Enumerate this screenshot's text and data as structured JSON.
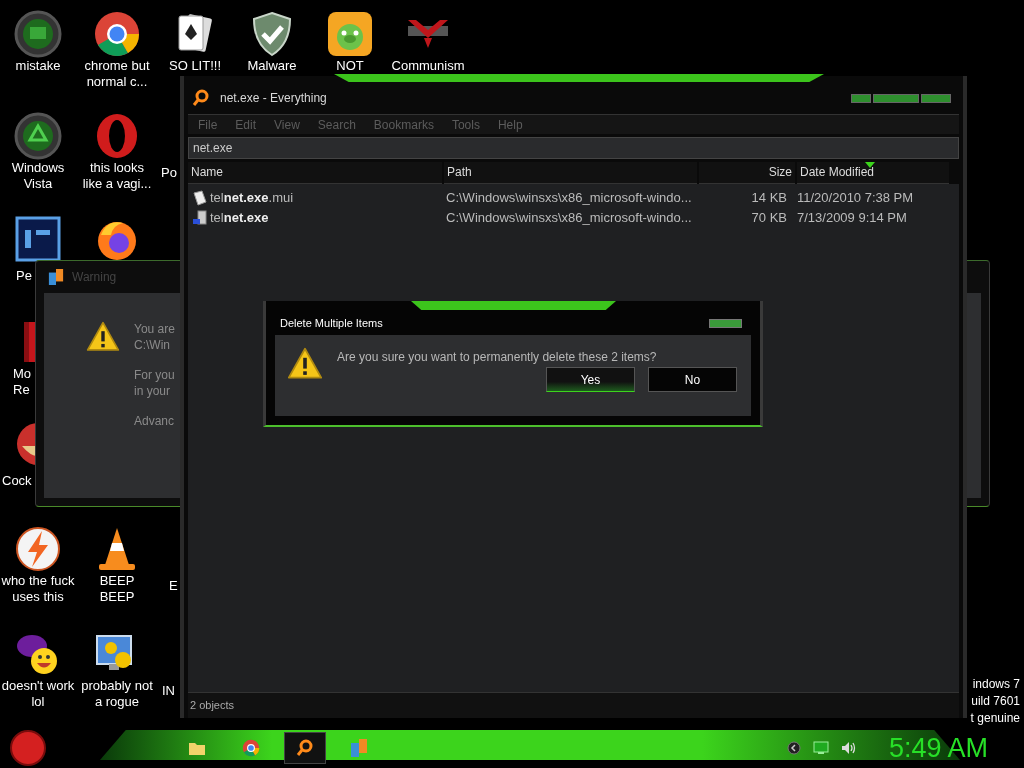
{
  "desktop": {
    "icons": [
      {
        "kind": "screen-orb",
        "lines": [
          "mistake"
        ]
      },
      {
        "kind": "chrome",
        "lines": [
          "chrome but",
          "normal c..."
        ]
      },
      {
        "kind": "cards",
        "lines": [
          "SO LIT!!!"
        ]
      },
      {
        "kind": "shield",
        "lines": [
          "Malware"
        ]
      },
      {
        "kind": "pig",
        "lines": [
          "NOT"
        ]
      },
      {
        "kind": "banner",
        "lines": [
          "Communism"
        ]
      },
      {
        "kind": "recycle-orb",
        "lines": [
          "Windows",
          "Vista"
        ]
      },
      {
        "kind": "opera",
        "lines": [
          "this looks",
          "like a vagi..."
        ]
      },
      {
        "kind": "none",
        "lines": [
          "Po"
        ]
      },
      {
        "kind": "photoshop",
        "lines": [
          "Pe"
        ]
      },
      {
        "kind": "firefox"
      },
      {
        "kind": "book",
        "lines": [
          "Mo",
          "Re"
        ]
      },
      {
        "kind": "bowl",
        "lines": [
          "Cock"
        ]
      },
      {
        "kind": "bolt",
        "lines": [
          "who the fuck",
          "uses this"
        ]
      },
      {
        "kind": "cone",
        "lines": [
          "BEEP",
          "BEEP"
        ]
      },
      {
        "kind": "none",
        "lines": [
          "E"
        ]
      },
      {
        "kind": "messenger",
        "lines": [
          "doesn't work",
          "lol"
        ]
      },
      {
        "kind": "monitor",
        "lines": [
          "probably not",
          "a rogue"
        ]
      },
      {
        "kind": "none",
        "lines": [
          "IN"
        ]
      }
    ],
    "notice_lines": [
      "indows 7",
      "uild 7601",
      "t genuine"
    ]
  },
  "warning_window": {
    "title": "Warning",
    "paragraphs": [
      [
        "You are",
        "C:\\Win"
      ],
      [
        "For you",
        "in your"
      ],
      [
        "Advanc"
      ]
    ]
  },
  "everything_window": {
    "title": "net.exe - Everything",
    "menu": [
      "File",
      "Edit",
      "View",
      "Search",
      "Bookmarks",
      "Tools",
      "Help"
    ],
    "search": {
      "value": "net.exe"
    },
    "columns": [
      {
        "label": "Name",
        "sorted": false
      },
      {
        "label": "Path",
        "sorted": false
      },
      {
        "label": "Size",
        "sorted": false
      },
      {
        "label": "Date Modified",
        "sorted": true
      }
    ],
    "rows": [
      {
        "kind": "document",
        "name": "tel**net.exe**.mui",
        "path": "C:\\Windows\\winsxs\\x86_microsoft-windo...",
        "size": "14 KB",
        "modified": "11/20/2010 7:38 PM"
      },
      {
        "kind": "executable",
        "name": "tel**net.exe**",
        "path": "C:\\Windows\\winsxs\\x86_microsoft-windo...",
        "size": "70 KB",
        "modified": "7/13/2009 9:14 PM"
      }
    ],
    "status": "2 objects"
  },
  "dialog": {
    "title": "Delete Multiple Items",
    "message": "Are you sure you want to permanently delete these 2 items?",
    "buttons": [
      {
        "label": "Yes",
        "default": true
      },
      {
        "label": "No",
        "default": false
      }
    ]
  },
  "taskbar": {
    "pinned": [
      {
        "kind": "folder",
        "selected": false
      },
      {
        "kind": "chrome",
        "selected": false
      },
      {
        "kind": "search",
        "selected": true
      },
      {
        "kind": "app",
        "selected": false
      }
    ],
    "tray": [
      {
        "kind": "chevron"
      },
      {
        "kind": "monitor"
      },
      {
        "kind": "speaker"
      }
    ],
    "clock": "5:49 AM"
  }
}
